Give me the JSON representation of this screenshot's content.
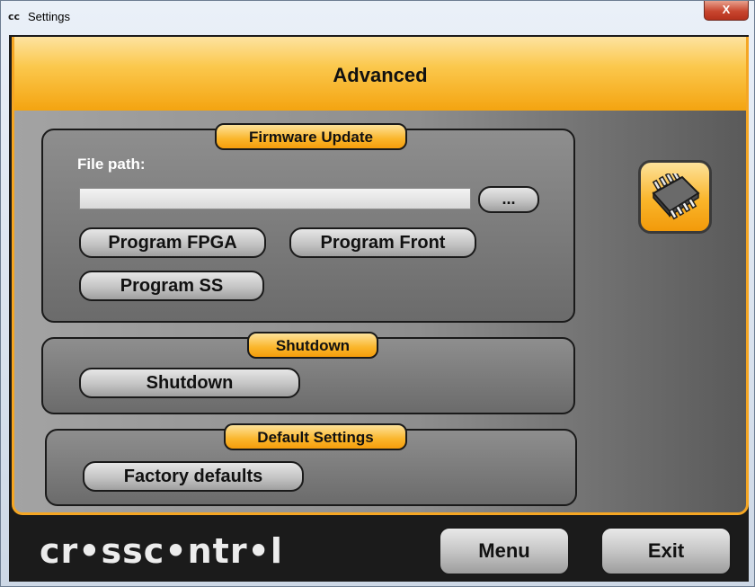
{
  "window": {
    "logo": "cc",
    "title": "Settings",
    "close_label": "X"
  },
  "header": {
    "title": "Advanced"
  },
  "firmware": {
    "title": "Firmware Update",
    "file_path_label": "File path:",
    "file_path_value": "",
    "browse_label": "...",
    "program_fpga_label": "Program FPGA",
    "program_front_label": "Program Front",
    "program_ss_label": "Program SS"
  },
  "shutdown": {
    "title": "Shutdown",
    "button_label": "Shutdown"
  },
  "defaults": {
    "title": "Default Settings",
    "button_label": "Factory defaults"
  },
  "footer": {
    "logo": "cr•ssc•ntr•l",
    "menu_label": "Menu",
    "exit_label": "Exit"
  },
  "colors": {
    "accent": "#f5a623",
    "background": "#1b1b1b"
  },
  "icons": {
    "chip": "chip-icon"
  }
}
